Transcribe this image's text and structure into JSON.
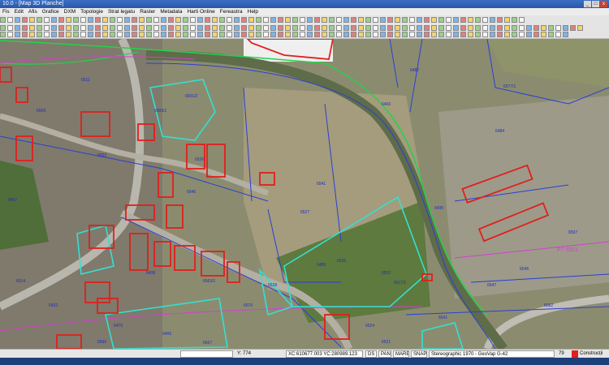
{
  "app": {
    "title": "10.0 - [Map 3D Planche]"
  },
  "window_controls": {
    "minimize": "_",
    "maximize": "□",
    "close": "x"
  },
  "menu": [
    "Fis",
    "Edit",
    "Afis",
    "Grafice",
    "DXM",
    "Topologie",
    "Strat legatu",
    "Raster",
    "Metadata",
    "Harti Online",
    "Fereastra",
    "Help"
  ],
  "colors": {
    "title_bar": "#2a57a8",
    "building_outline": "#e0201c",
    "parcel_outline": "#33e0d2",
    "cadastral_line": "#2b3fd6",
    "road_line": "#22d34a",
    "magenta_line": "#d23fd0"
  },
  "map": {
    "labels": [
      "6501/2",
      "6511",
      "6509",
      "6553",
      "6526",
      "6541",
      "6527",
      "6546",
      "6495",
      "6466",
      "6487",
      "6484",
      "6552",
      "6517/1",
      "6535",
      "6528",
      "6489",
      "6408",
      "6563/1",
      "6570",
      "6432",
      "6475",
      "6455",
      "6524",
      "6541",
      "6547",
      "6546",
      "6582",
      "6597",
      "6577/1",
      "6514",
      "6566",
      "6567",
      "6521",
      "6407",
      "6509/1"
    ],
    "pink_label": "P7 5921"
  },
  "status": {
    "coordinates": "Y: 774",
    "xy": "XC:610677.003 YC:280989.123",
    "flags": [
      "DS",
      "PAN",
      "MARE",
      "SNAP"
    ],
    "info": "Stereographic 1970 - GeoVap G-42",
    "zoom": "79",
    "layer": "Construcții"
  }
}
